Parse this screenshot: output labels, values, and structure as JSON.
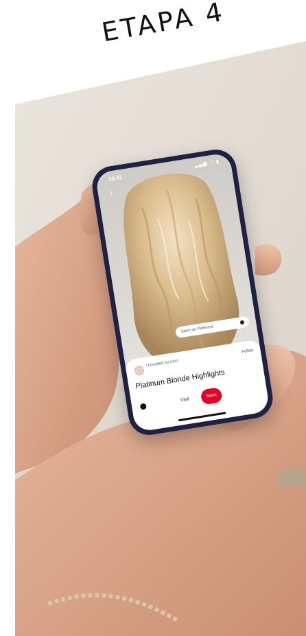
{
  "heading": "ETAPA 4",
  "phone": {
    "status_time": "16:41",
    "status_icons": "▂▄▆ ◠ ▮",
    "back_icon": "‹",
    "more_icon": "···",
    "tag_text": "Seen on Pinterest",
    "creator_line1": "Uploaded by user",
    "creator_line2": "",
    "follow_label": "Follow",
    "pin_title": "Platinum Blonde Highlights",
    "visit_label": "Visit",
    "save_label": "Save"
  },
  "colors": {
    "save_red": "#e60023",
    "phone_frame": "#1f2144",
    "backdrop": "#e6e0d8"
  }
}
